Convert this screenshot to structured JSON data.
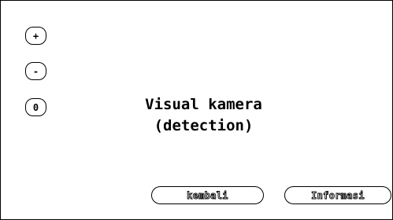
{
  "zoom_controls": {
    "zoom_in_label": "+",
    "zoom_out_label": "-",
    "reset_label": "0"
  },
  "main": {
    "title_line1": "Visual kamera",
    "title_line2": "(detection)"
  },
  "footer": {
    "back_label": "kembali",
    "info_label": "Informasi"
  }
}
